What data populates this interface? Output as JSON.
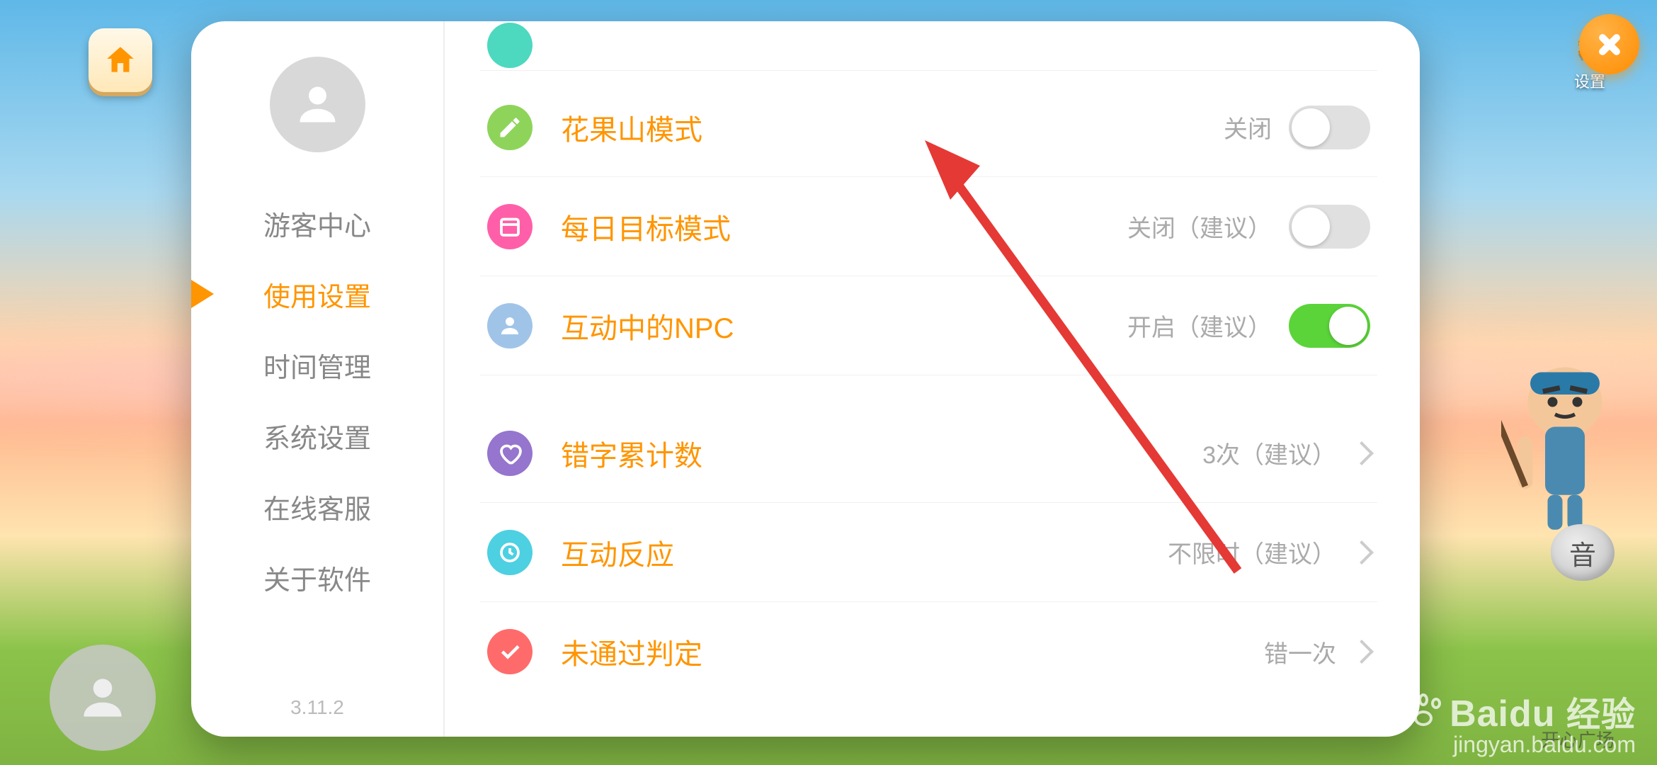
{
  "nav": {
    "home_label": "",
    "gear_label": "设置"
  },
  "sidebar": {
    "items": [
      {
        "label": "游客中心"
      },
      {
        "label": "使用设置"
      },
      {
        "label": "时间管理"
      },
      {
        "label": "系统设置"
      },
      {
        "label": "在线客服"
      },
      {
        "label": "关于软件"
      }
    ],
    "version": "3.11.2"
  },
  "settings": {
    "rows": [
      {
        "title": "花果山模式",
        "status": "关闭",
        "type": "toggle",
        "on": false
      },
      {
        "title": "每日目标模式",
        "status": "关闭（建议）",
        "type": "toggle",
        "on": false
      },
      {
        "title": "互动中的NPC",
        "status": "开启（建议）",
        "type": "toggle",
        "on": true
      },
      {
        "title": "错字累计数",
        "status": "3次（建议）",
        "type": "link"
      },
      {
        "title": "互动反应",
        "status": "不限时（建议）",
        "type": "link"
      },
      {
        "title": "未通过判定",
        "status": "错一次",
        "type": "link"
      }
    ]
  },
  "watermark": {
    "brand": "Baidu",
    "cn": "经验",
    "url": "jingyan.baidu.com"
  },
  "bg_nav_right": "开心广场",
  "stone_label": "音"
}
